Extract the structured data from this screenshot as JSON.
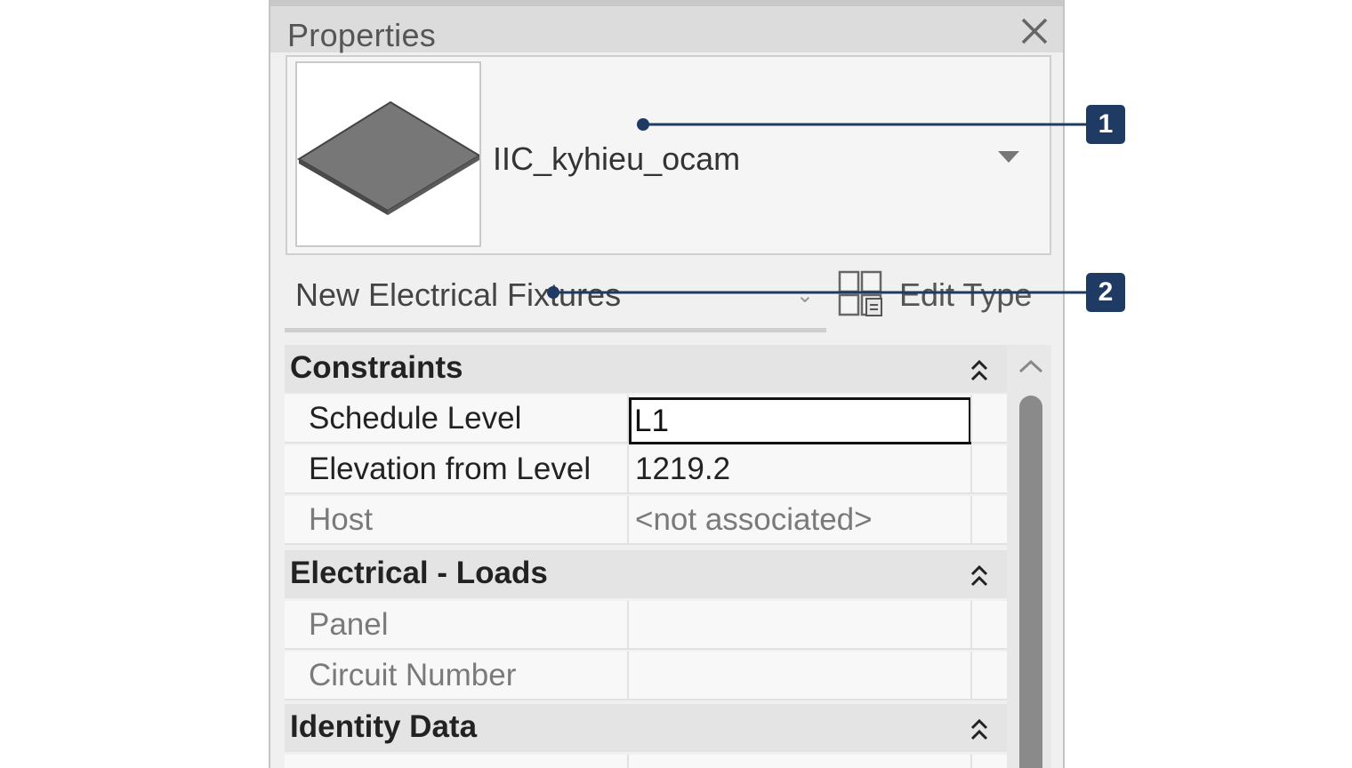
{
  "panel": {
    "title": "Properties",
    "type_selector": {
      "name": "IIC_kyhieu_ocam"
    },
    "instance_filter": {
      "label": "New Electrical Fixtures"
    },
    "edit_type": {
      "label": "Edit Type"
    }
  },
  "groups": {
    "constraints": {
      "label": "Constraints",
      "schedule_level": {
        "name": "Schedule Level",
        "value": "L1"
      },
      "elevation": {
        "name": "Elevation from Level",
        "value": "1219.2"
      },
      "host": {
        "name": "Host",
        "value": "<not associated>"
      }
    },
    "electrical_loads": {
      "label": "Electrical - Loads",
      "panel": {
        "name": "Panel",
        "value": ""
      },
      "circuit_number": {
        "name": "Circuit Number",
        "value": ""
      }
    },
    "identity_data": {
      "label": "Identity Data"
    }
  },
  "callouts": [
    "1",
    "2"
  ],
  "colors": {
    "callout": "#1f3b63",
    "panel_bg": "#f0f0f0",
    "header_bg": "#dcdcdc"
  }
}
